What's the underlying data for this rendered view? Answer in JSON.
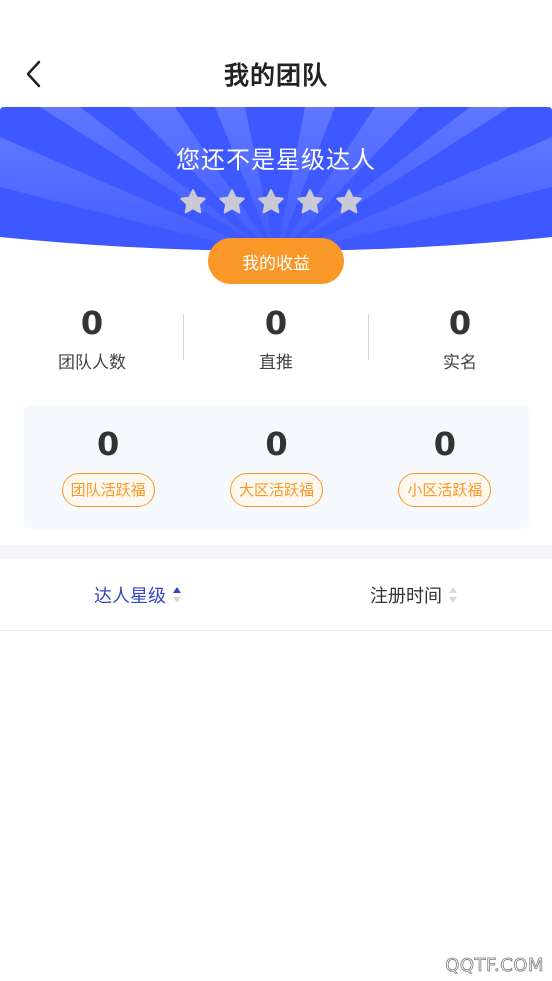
{
  "nav": {
    "title": "我的团队",
    "back_icon": "chevron-left-icon"
  },
  "banner": {
    "title": "您还不是星级达人",
    "star_count": 5,
    "stars_filled": 0,
    "earnings_button": "我的收益",
    "colors": {
      "banner": "#3d58ff",
      "button": "#f99728",
      "star": "#c9cad6"
    }
  },
  "stats": [
    {
      "value": "0",
      "label": "团队人数"
    },
    {
      "value": "0",
      "label": "直推"
    },
    {
      "value": "0",
      "label": "实名"
    }
  ],
  "bonus": [
    {
      "value": "0",
      "label": "团队活跃福"
    },
    {
      "value": "0",
      "label": "大区活跃福"
    },
    {
      "value": "0",
      "label": "小区活跃福"
    }
  ],
  "sort_tabs": [
    {
      "label": "达人星级",
      "active": true,
      "direction": "asc"
    },
    {
      "label": "注册时间",
      "active": false,
      "direction": "none"
    }
  ],
  "watermark": "QQTF.COM"
}
